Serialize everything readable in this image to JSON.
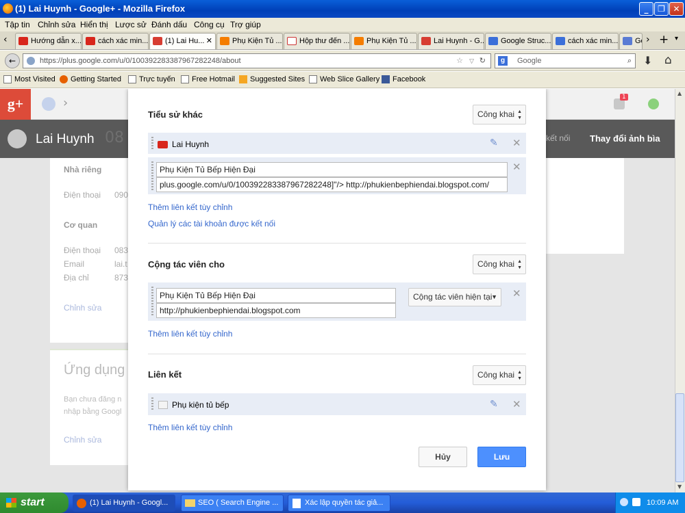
{
  "window": {
    "title": "(1) Lai Huynh - Google+ - Mozilla Firefox"
  },
  "menu": [
    "Tập tin",
    "Chỉnh sửa",
    "Hiển thị",
    "Lược sử",
    "Đánh dấu",
    "Công cụ",
    "Trợ giúp"
  ],
  "tabs": [
    {
      "label": "Hướng dẫn x...",
      "icon": "youtube-icon"
    },
    {
      "label": "cách xác min...",
      "icon": "youtube-icon"
    },
    {
      "label": "(1) Lai Hu...",
      "icon": "google-plus-icon"
    },
    {
      "label": "Phụ Kiện Tủ ...",
      "icon": "blogger-icon"
    },
    {
      "label": "Hộp thư đến ...",
      "icon": "gmail-icon"
    },
    {
      "label": "Phụ Kiện Tủ ...",
      "icon": "blogger-icon"
    },
    {
      "label": "Lai Huynh - G...",
      "icon": "google-plus-icon"
    },
    {
      "label": "Google Struc...",
      "icon": "google-icon"
    },
    {
      "label": "cách xác min...",
      "icon": "google-icon"
    },
    {
      "label": "Go",
      "icon": "docs-icon"
    }
  ],
  "nav": {
    "url": "https://plus.google.com/u/0/100392283387967282248/about",
    "search_placeholder": "Google"
  },
  "bookmarks": [
    "Most Visited",
    "Getting Started",
    "Trực tuyến",
    "Free Hotmail",
    "Suggested Sites",
    "Web Slice Gallery",
    "Facebook"
  ],
  "gplus": {
    "logo": "g+",
    "notif_count": "1",
    "profile_name": "Lai Huynh",
    "profile_number": "08",
    "change_cover": "Thay đổi ảnh bìa",
    "connected": "kết nối"
  },
  "left_panel": {
    "home": "Nhà riêng",
    "home_phone_label": "Điện thoại",
    "home_phone_value": "090",
    "work": "Cơ quan",
    "work_phone_label": "Điện thoại",
    "work_phone_value": "083",
    "email_label": "Email",
    "email_value": "lai.t",
    "address_label": "Địa chỉ",
    "address_value": "873",
    "edit": "Chỉnh sửa",
    "apps_title": "Ứng dụng",
    "apps_text1": "Bạn chưa đăng n",
    "apps_text2": "nhập bằng Googl",
    "apps_edit": "Chỉnh sửa"
  },
  "dialog": {
    "profiles": {
      "title": "Tiểu sử khác",
      "visibility": "Công khai",
      "youtube_item": "Lai Huynh",
      "link_name": "Phụ Kiện Tủ Bếp Hiện Đại",
      "link_url": "plus.google.com/u/0/100392283387967282248]\"/> http://phukienbephiendai.blogspot.com/",
      "add_custom": "Thêm liên kết tùy chỉnh",
      "manage": "Quản lý các tài khoản được kết nối"
    },
    "contributor": {
      "title": "Cộng tác viên cho",
      "visibility": "Công khai",
      "site_name": "Phụ Kiện Tủ Bếp Hiện Đại",
      "site_url": "http://phukienbephiendai.blogspot.com",
      "status": "Cộng tác viên hiện tại",
      "add_custom": "Thêm liên kết tùy chỉnh"
    },
    "links": {
      "title": "Liên kết",
      "visibility": "Công khai",
      "item": "Phụ kiện tủ bếp",
      "add_custom": "Thêm liên kết tùy chỉnh"
    },
    "cancel": "Hủy",
    "save": "Lưu"
  },
  "taskbar": {
    "start": "start",
    "items": [
      "(1) Lai Huynh - Googl...",
      "SEO ( Search Engine ...",
      "Xác lập quyền tác giả..."
    ],
    "clock": "10:09 AM"
  }
}
